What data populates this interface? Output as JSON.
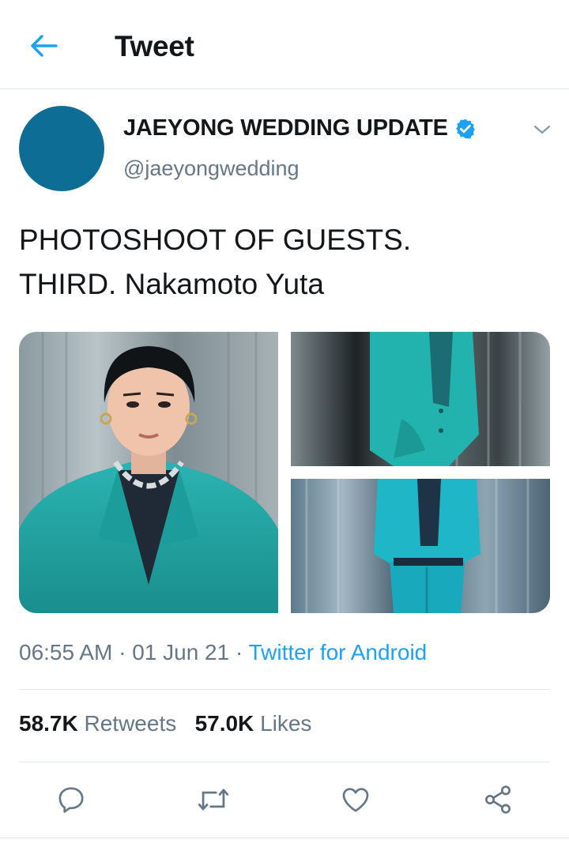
{
  "header": {
    "title": "Tweet",
    "back_icon": "arrow-left-icon",
    "accent": "#1da1f2"
  },
  "tweet": {
    "display_name": "JAEYONG WEDDING UPDATE",
    "handle": "@jaeyongwedding",
    "verified": true,
    "avatar_color": "#0e6d94",
    "text_lines": [
      "PHOTOSHOOT OF GUESTS.",
      "THIRD. Nakamoto Yuta"
    ],
    "media": [
      {
        "name": "photo-portrait",
        "subject": "man in teal suit with chain necklace, close-up"
      },
      {
        "name": "photo-suit-detail",
        "subject": "teal suit jacket with hand in pocket"
      },
      {
        "name": "photo-suit-full",
        "subject": "teal suit, torso and trousers"
      }
    ],
    "time": "06:55 AM",
    "date": "01 Jun 21",
    "separator": "·",
    "source": "Twitter for Android"
  },
  "stats": {
    "retweets_count": "58.7K",
    "retweets_label": "Retweets",
    "likes_count": "57.0K",
    "likes_label": "Likes"
  },
  "actions": {
    "icons": [
      "reply-icon",
      "retweet-icon",
      "like-icon",
      "share-icon"
    ],
    "icon_color": "#657786"
  }
}
